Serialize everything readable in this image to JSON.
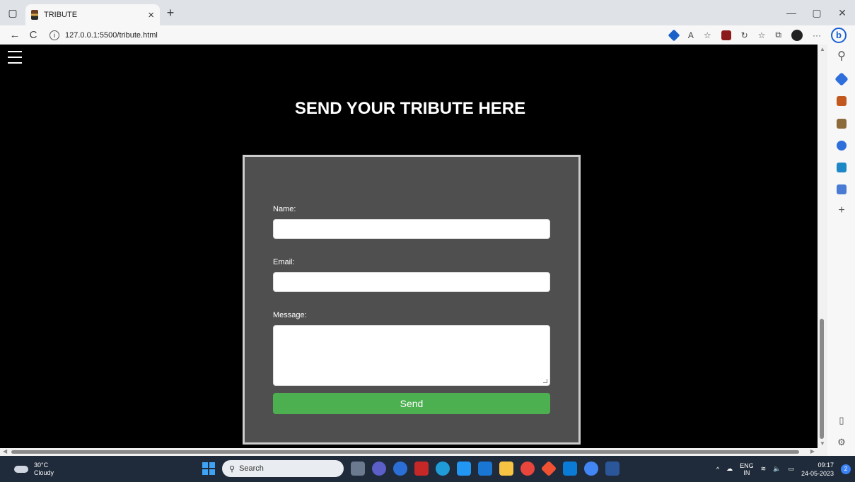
{
  "browser": {
    "tab_title": "TRIBUTE",
    "tab_close": "×",
    "new_tab": "+",
    "url": "127.0.0.1:5500/tribute.html",
    "back": "←",
    "reload": "C",
    "more": "···",
    "bing_label": "b"
  },
  "page": {
    "title": "SEND YOUR TRIBUTE HERE",
    "form": {
      "name_label": "Name:",
      "name_value": "",
      "email_label": "Email:",
      "email_value": "",
      "message_label": "Message:",
      "message_value": "",
      "send_label": "Send"
    }
  },
  "taskbar": {
    "temperature": "30°C",
    "weather": "Cloudy",
    "search_label": "Search",
    "lang_top": "ENG",
    "lang_bottom": "IN",
    "time": "09:17",
    "date": "24-05-2023",
    "notifications": "2"
  },
  "colors": {
    "form_bg": "#4f4f4f",
    "send_button": "#4caf50",
    "page_bg": "#000000"
  }
}
